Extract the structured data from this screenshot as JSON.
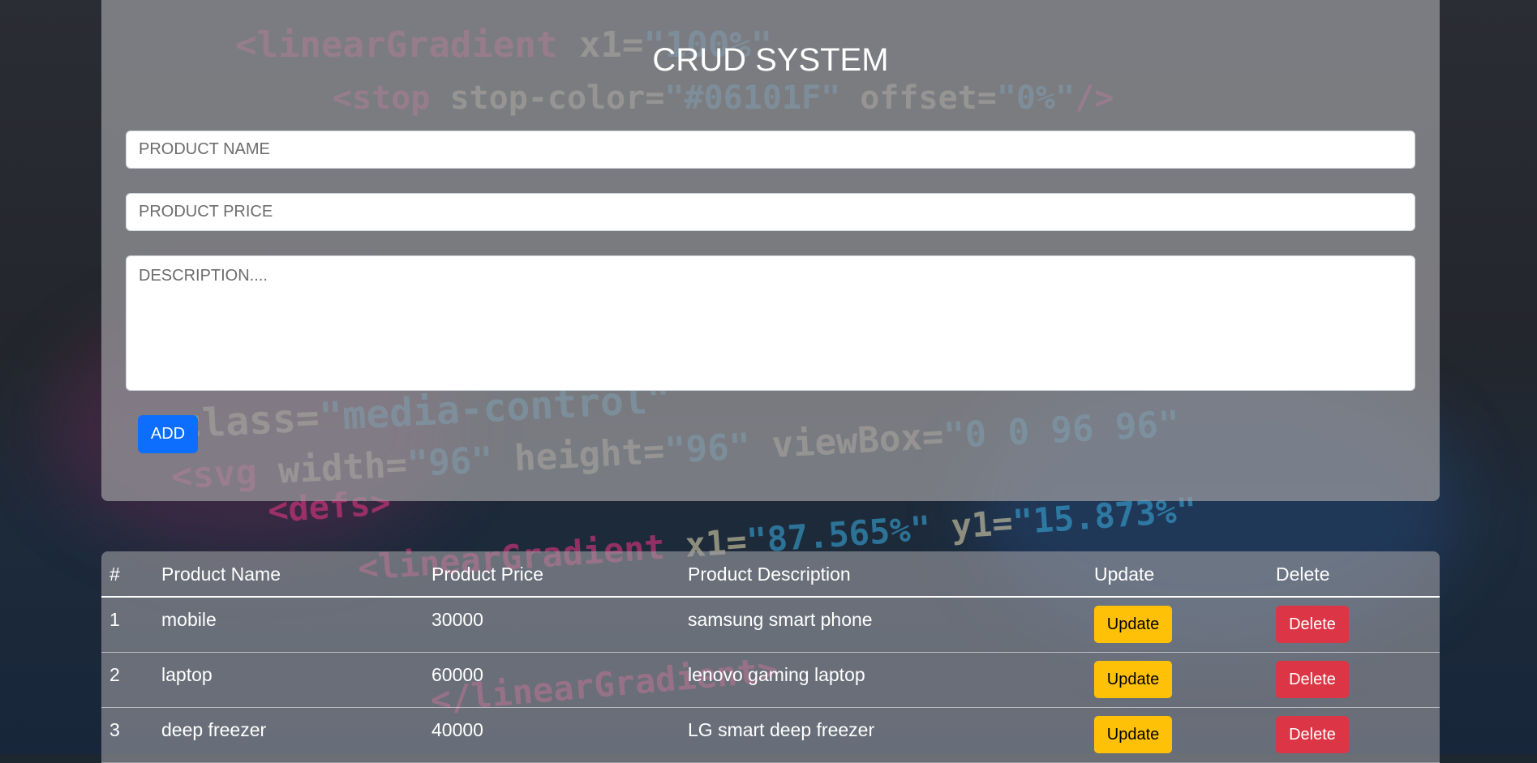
{
  "colors": {
    "primary": "#0d6efd",
    "warning": "#ffc107",
    "danger": "#dc3545"
  },
  "header": {
    "title": "CRUD SYSTEM"
  },
  "form": {
    "name_placeholder": "PRODUCT NAME",
    "price_placeholder": "PRODUCT PRICE",
    "description_placeholder": "DESCRIPTION....",
    "add_label": "ADD"
  },
  "table": {
    "columns": [
      "#",
      "Product Name",
      "Product Price",
      "Product Description",
      "Update",
      "Delete"
    ],
    "rows": [
      {
        "index": "1",
        "name": "mobile",
        "price": "30000",
        "description": "samsung smart phone",
        "update_label": "Update",
        "delete_label": "Delete"
      },
      {
        "index": "2",
        "name": "laptop",
        "price": "60000",
        "description": "lenovo gaming laptop",
        "update_label": "Update",
        "delete_label": "Delete"
      },
      {
        "index": "3",
        "name": "deep freezer",
        "price": "40000",
        "description": "LG smart deep freezer",
        "update_label": "Update",
        "delete_label": "Delete"
      }
    ]
  }
}
